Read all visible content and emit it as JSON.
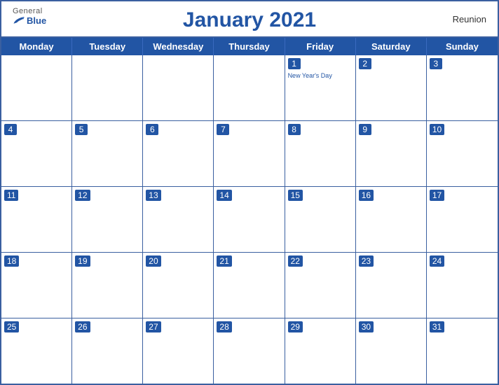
{
  "header": {
    "logo_general": "General",
    "logo_blue": "Blue",
    "title": "January 2021",
    "region": "Reunion"
  },
  "days": [
    "Monday",
    "Tuesday",
    "Wednesday",
    "Thursday",
    "Friday",
    "Saturday",
    "Sunday"
  ],
  "weeks": [
    [
      {
        "num": "",
        "empty": true
      },
      {
        "num": "",
        "empty": true
      },
      {
        "num": "",
        "empty": true
      },
      {
        "num": "",
        "empty": true
      },
      {
        "num": "1",
        "holiday": "New Year's Day"
      },
      {
        "num": "2"
      },
      {
        "num": "3"
      }
    ],
    [
      {
        "num": "4"
      },
      {
        "num": "5"
      },
      {
        "num": "6"
      },
      {
        "num": "7"
      },
      {
        "num": "8"
      },
      {
        "num": "9"
      },
      {
        "num": "10"
      }
    ],
    [
      {
        "num": "11"
      },
      {
        "num": "12"
      },
      {
        "num": "13"
      },
      {
        "num": "14"
      },
      {
        "num": "15"
      },
      {
        "num": "16"
      },
      {
        "num": "17"
      }
    ],
    [
      {
        "num": "18"
      },
      {
        "num": "19"
      },
      {
        "num": "20"
      },
      {
        "num": "21"
      },
      {
        "num": "22"
      },
      {
        "num": "23"
      },
      {
        "num": "24"
      }
    ],
    [
      {
        "num": "25"
      },
      {
        "num": "26"
      },
      {
        "num": "27"
      },
      {
        "num": "28"
      },
      {
        "num": "29"
      },
      {
        "num": "30"
      },
      {
        "num": "31"
      }
    ]
  ],
  "colors": {
    "primary": "#2255a4",
    "border": "#3a5fa0"
  }
}
